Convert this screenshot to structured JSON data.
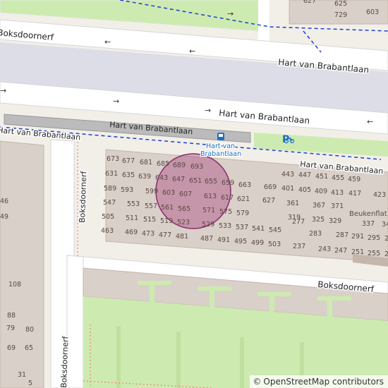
{
  "map": {
    "streets": {
      "top_left": "Boksdoornerf",
      "hart_upper": "Hart van Brabantlaan",
      "hart_middle": "Hart van Brabantlaan",
      "hart_left": "Hart van Brabantlaan",
      "hart_right": "Hart van Brabantlaan",
      "boksdoornerf_vertical": "Boksdoornerf",
      "boksdoornerf_lower": "Boksdoornerf",
      "boksdoornerf_bottom_left": "Boksdoornerf"
    },
    "bus_stop": {
      "line1": "Hart van",
      "line2": "Brabantlaan"
    },
    "building_name": "Beukenflat",
    "house_numbers": [
      "627",
      "625",
      "729",
      "603",
      "673",
      "677",
      "681",
      "685",
      "689",
      "693",
      "631",
      "635",
      "639",
      "643",
      "647",
      "651",
      "655",
      "659",
      "589",
      "593",
      "599",
      "603",
      "607",
      "613",
      "617",
      "663",
      "547",
      "553",
      "557",
      "561",
      "565",
      "571",
      "575",
      "579",
      "621",
      "627",
      "505",
      "511",
      "515",
      "519",
      "523",
      "529",
      "533",
      "537",
      "541",
      "545",
      "277",
      "463",
      "469",
      "473",
      "477",
      "481",
      "487",
      "491",
      "495",
      "499",
      "503",
      "237",
      "443",
      "447",
      "451",
      "455",
      "459",
      "669",
      "401",
      "405",
      "409",
      "413",
      "417",
      "423",
      "361",
      "367",
      "371",
      "319",
      "325",
      "329",
      "337",
      "34",
      "283",
      "287",
      "291",
      "295",
      "29",
      "243",
      "247",
      "251",
      "255",
      "25",
      "46",
      "49",
      "108",
      "88",
      "79",
      "80",
      "69",
      "65",
      "31",
      "5"
    ],
    "parking_label": "P",
    "icons": [
      "bus-stop-icon",
      "parking-icon",
      "bicycle-icon"
    ],
    "colors": {
      "background": "#f2efe9",
      "road": "#ffffff",
      "pedestrian": "#dddde8",
      "building": "#d9d0c9",
      "building_outline": "#c4b6ab",
      "grass": "#cdebb0",
      "platform": "#bbbbbb",
      "route_blue": "#1a3fd1",
      "footpath_red": "#fa8072",
      "highlight": "rgba(160,40,110,0.35)",
      "bus_stop": "#1e6fc0"
    }
  },
  "attribution": {
    "symbol": "©",
    "text": "OpenStreetMap contributors"
  }
}
